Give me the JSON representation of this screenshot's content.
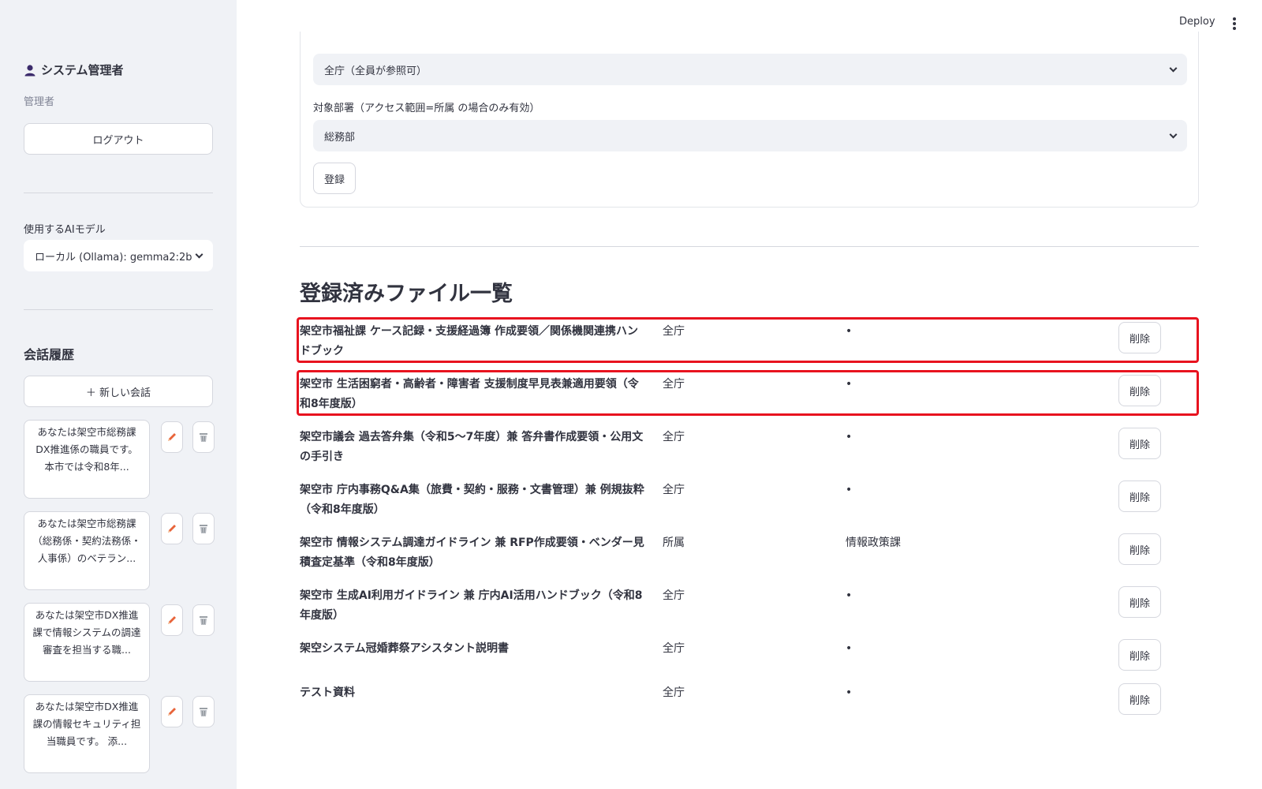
{
  "header": {
    "deploy_label": "Deploy"
  },
  "sidebar": {
    "user_name": "システム管理者",
    "user_role": "管理者",
    "logout_label": "ログアウト",
    "model_label": "使用するAIモデル",
    "model_value": "ローカル (Ollama): gemma2:2b",
    "history_title": "会話履歴",
    "new_chat_label": "＋ 新しい会話",
    "conversations": [
      {
        "preview": "あなたは架空市総務課DX推進係の職員です。 本市では令和8年..."
      },
      {
        "preview": "あなたは架空市総務課（総務係・契約法務係・人事係）のベテラン..."
      },
      {
        "preview": "あなたは架空市DX推進課で情報システムの調達審査を担当する職..."
      },
      {
        "preview": "あなたは架空市DX推進課の情報セキュリティ担当職員です。 添..."
      }
    ]
  },
  "form": {
    "access_value": "全庁（全員が参照可）",
    "dept_label": "対象部署（アクセス範囲=所属 の場合のみ有効）",
    "dept_value": "総務部",
    "register_label": "登録"
  },
  "file_list": {
    "title": "登録済みファイル一覧",
    "delete_label": "削除",
    "rows": [
      {
        "name": "架空市福祉課 ケース記録・支援経過簿 作成要領／関係機関連携ハンドブック",
        "access": "全庁",
        "dept": "•",
        "highlighted": true
      },
      {
        "name": "架空市 生活困窮者・高齢者・障害者 支援制度早見表兼適用要領（令和8年度版）",
        "access": "全庁",
        "dept": "•",
        "highlighted": true
      },
      {
        "name": "架空市議会 過去答弁集（令和5〜7年度）兼 答弁書作成要領・公用文の手引き",
        "access": "全庁",
        "dept": "•",
        "highlighted": false
      },
      {
        "name": "架空市 庁内事務Q&A集（旅費・契約・服務・文書管理）兼 例規抜粋（令和8年度版）",
        "access": "全庁",
        "dept": "•",
        "highlighted": false
      },
      {
        "name": "架空市 情報システム調達ガイドライン 兼 RFP作成要領・ベンダー見積査定基準（令和8年度版）",
        "access": "所属",
        "dept": "情報政策課",
        "highlighted": false
      },
      {
        "name": "架空市 生成AI利用ガイドライン 兼 庁内AI活用ハンドブック（令和8年度版）",
        "access": "全庁",
        "dept": "•",
        "highlighted": false
      },
      {
        "name": "架空システム冠婚葬祭アシスタント説明書",
        "access": "全庁",
        "dept": "•",
        "highlighted": false
      },
      {
        "name": "テスト資料",
        "access": "全庁",
        "dept": "•",
        "highlighted": false
      }
    ]
  },
  "colors": {
    "highlight": "#e8131f",
    "sidebar_bg": "#f0f2f6",
    "pencil": "#e8643a"
  }
}
